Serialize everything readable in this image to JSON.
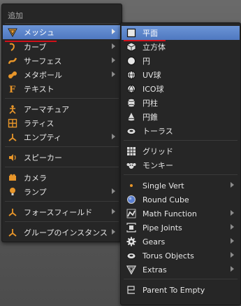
{
  "menu_main": {
    "title": "追加",
    "items": [
      {
        "label": "メッシュ",
        "icon": "mesh-cone-icon"
      },
      {
        "label": "カーブ",
        "icon": "curve-icon"
      },
      {
        "label": "サーフェス",
        "icon": "surface-icon"
      },
      {
        "label": "メタボール",
        "icon": "metaball-icon"
      },
      {
        "label": "テキスト",
        "icon": "text-f-icon"
      },
      {
        "label": "アーマチュア",
        "icon": "armature-icon"
      },
      {
        "label": "ラティス",
        "icon": "lattice-icon"
      },
      {
        "label": "エンプティ",
        "icon": "empty-axis-icon"
      },
      {
        "label": "スピーカー",
        "icon": "speaker-icon"
      },
      {
        "label": "カメラ",
        "icon": "camera-icon"
      },
      {
        "label": "ランプ",
        "icon": "lamp-icon"
      },
      {
        "label": "フォースフィールド",
        "icon": "force-field-icon"
      },
      {
        "label": "グループのインスタンス",
        "icon": "group-instance-icon"
      }
    ]
  },
  "menu_mesh": {
    "items": [
      {
        "label": "平面",
        "icon": "plane-icon"
      },
      {
        "label": "立方体",
        "icon": "cube-icon"
      },
      {
        "label": "円",
        "icon": "circle-icon"
      },
      {
        "label": "UV球",
        "icon": "uv-sphere-icon"
      },
      {
        "label": "ICO球",
        "icon": "ico-sphere-icon"
      },
      {
        "label": "円柱",
        "icon": "cylinder-icon"
      },
      {
        "label": "円錐",
        "icon": "cone-icon"
      },
      {
        "label": "トーラス",
        "icon": "torus-icon"
      },
      {
        "label": "グリッド",
        "icon": "grid-icon"
      },
      {
        "label": "モンキー",
        "icon": "monkey-icon"
      },
      {
        "label": "Single Vert",
        "icon": "single-vert-icon"
      },
      {
        "label": "Round Cube",
        "icon": "round-cube-icon"
      },
      {
        "label": "Math Function",
        "icon": "math-function-icon"
      },
      {
        "label": "Pipe Joints",
        "icon": "pipe-joints-icon"
      },
      {
        "label": "Gears",
        "icon": "gears-icon"
      },
      {
        "label": "Torus Objects",
        "icon": "torus-objects-icon"
      },
      {
        "label": "Extras",
        "icon": "extras-icon"
      },
      {
        "label": "Parent To Empty",
        "icon": "parent-empty-icon"
      }
    ]
  },
  "colors": {
    "highlight": "#5a84cc",
    "menu_bg": "#262626",
    "accent_red": "#d0101a"
  }
}
